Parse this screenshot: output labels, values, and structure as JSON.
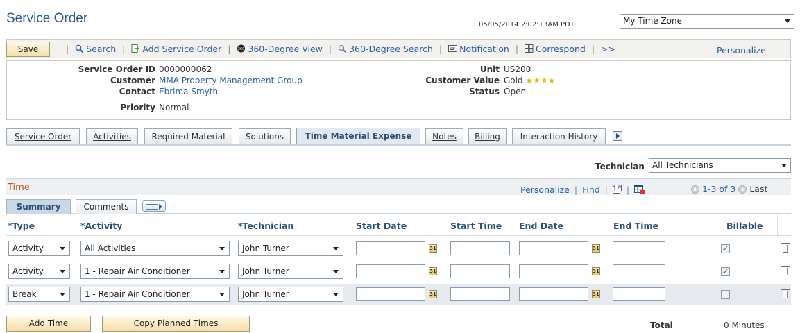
{
  "page": {
    "title": "Service Order",
    "datetime": "05/05/2014 2:02:13AM PDT",
    "timezone": "My Time Zone"
  },
  "toolbar": {
    "save_label": "Save",
    "search": "Search",
    "add_service_order": "Add Service Order",
    "view_360": "360-Degree View",
    "search_360": "360-Degree Search",
    "notification": "Notification",
    "correspond": "Correspond",
    "more": ">>",
    "personalize": "Personalize",
    "separator": "|"
  },
  "header": {
    "service_order_id_label": "Service Order ID",
    "service_order_id": "0000000062",
    "customer_label": "Customer",
    "customer": "MMA Property Management Group",
    "contact_label": "Contact",
    "contact": "Ebrima Smyth",
    "priority_label": "Priority",
    "priority": "Normal",
    "unit_label": "Unit",
    "unit": "US200",
    "customer_value_label": "Customer Value",
    "customer_value": "Gold",
    "customer_value_stars": 4,
    "status_label": "Status",
    "status": "Open"
  },
  "tabs": [
    {
      "label": "Service Order"
    },
    {
      "label": "Activities"
    },
    {
      "label": "Required Material"
    },
    {
      "label": "Solutions"
    },
    {
      "label": "Time Material Expense"
    },
    {
      "label": "Notes"
    },
    {
      "label": "Billing"
    },
    {
      "label": "Interaction History"
    }
  ],
  "active_tab": "Time Material Expense",
  "technician_filter": {
    "label": "Technician",
    "value": "All Technicians"
  },
  "time_grid": {
    "title": "Time",
    "personalize": "Personalize",
    "find": "Find",
    "separator": "|",
    "pager": "1-3 of 3",
    "last": "Last",
    "subtabs": [
      "Summary",
      "Comments"
    ],
    "columns": [
      "*Type",
      "*Activity",
      "*Technician",
      "Start Date",
      "Start Time",
      "End Date",
      "End Time",
      "Billable"
    ],
    "rows": [
      {
        "type": "Activity",
        "activity": "All Activities",
        "technician": "John Turner",
        "start_date": "",
        "start_time": "",
        "end_date": "",
        "end_time": "",
        "billable": true
      },
      {
        "type": "Activity",
        "activity": "1 - Repair Air Conditioner",
        "technician": "John Turner",
        "start_date": "",
        "start_time": "",
        "end_date": "",
        "end_time": "",
        "billable": true
      },
      {
        "type": "Break",
        "activity": "1 - Repair Air Conditioner",
        "technician": "John Turner",
        "start_date": "",
        "start_time": "",
        "end_date": "",
        "end_time": "",
        "billable": false
      }
    ]
  },
  "footer": {
    "add_time": "Add Time",
    "copy_planned_times": "Copy Planned Times",
    "total_label": "Total",
    "total_value": "0 Minutes"
  },
  "colors": {
    "link": "#2a5da8",
    "title": "#2b5a8e",
    "grid_title": "#b05a1e",
    "star": "#e6b800"
  }
}
